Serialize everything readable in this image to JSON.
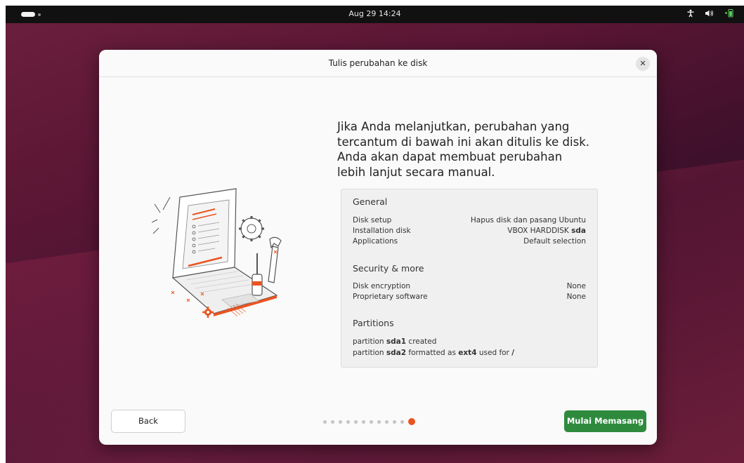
{
  "topbar": {
    "clock": "Aug 29  14:24",
    "icons": [
      "activities-indicator",
      "accessibility-icon",
      "volume-icon",
      "battery-icon"
    ]
  },
  "dialog": {
    "title": "Tulis perubahan ke disk",
    "heading": "Jika Anda melanjutkan, perubahan yang tercantum di bawah ini akan ditulis ke disk. Anda akan dapat membuat perubahan lebih lanjut secara manual.",
    "summary": {
      "general_title": "General",
      "general_rows": [
        {
          "label": "Disk setup",
          "value": "Hapus disk dan pasang Ubuntu"
        },
        {
          "label": "Installation disk",
          "value_prefix": "VBOX HARDDISK ",
          "value_bold": "sda"
        },
        {
          "label": "Applications",
          "value": "Default selection"
        }
      ],
      "security_title": "Security & more",
      "security_rows": [
        {
          "label": "Disk encryption",
          "value": "None"
        },
        {
          "label": "Proprietary software",
          "value": "None"
        }
      ],
      "partitions_title": "Partitions",
      "partition_lines": [
        {
          "p1": "partition ",
          "b1": "sda1",
          "p2": " created"
        },
        {
          "p1": "partition ",
          "b1": "sda2",
          "p2": " formatted as ",
          "b2": "ext4",
          "p3": " used for ",
          "b3": "/"
        }
      ]
    },
    "back_label": "Back",
    "install_label": "Mulai Memasang",
    "progress": {
      "total_steps": 12,
      "current_step": 12
    }
  },
  "colors": {
    "accent": "#e95420",
    "install_button": "#2e8b3e",
    "topbar": "#111111",
    "dialog_bg": "#fafafa"
  }
}
